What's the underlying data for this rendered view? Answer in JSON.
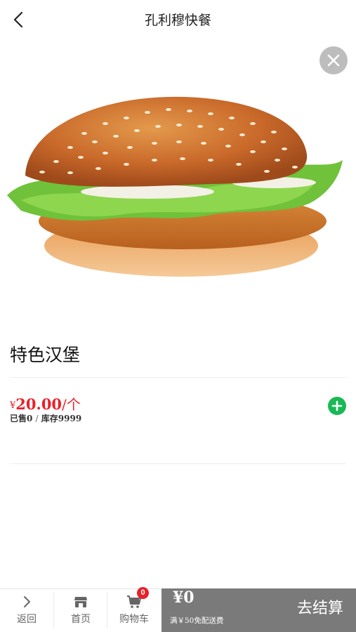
{
  "header": {
    "title": "孔利穆快餐"
  },
  "product": {
    "name": "特色汉堡",
    "price_currency": "¥",
    "price_amount": "20.00",
    "price_unit": "/个",
    "sold": "已售0",
    "separator": "/",
    "stock": "库存9999"
  },
  "bottom_nav": {
    "back_label": "返回",
    "home_label": "首页",
    "cart_label": "购物车",
    "cart_badge": "0"
  },
  "checkout": {
    "total": "¥0",
    "delivery_note": "满￥50免配送费",
    "button_label": "去结算"
  },
  "colors": {
    "price_red": "#e8212a",
    "add_green": "#19b955",
    "checkout_gray": "#7a7a7a"
  }
}
